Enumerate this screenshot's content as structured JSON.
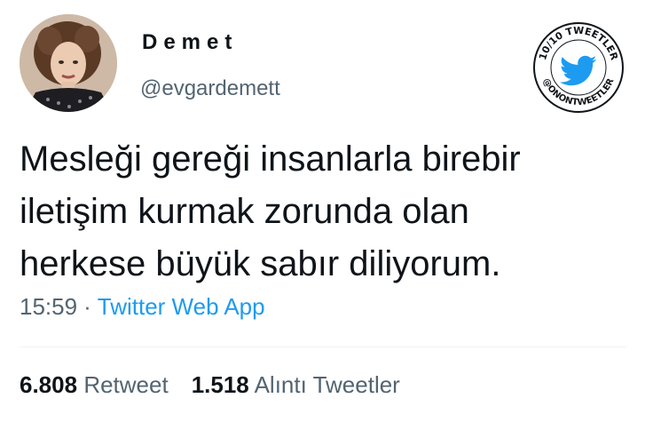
{
  "tweet": {
    "author": {
      "display_name": "Demet",
      "handle": "@evgardemett",
      "avatar_icon": "profile-photo"
    },
    "text_lines": [
      "Mesleği gereği insanlarla birebir",
      "iletişim kurmak zorunda olan",
      "herkese büyük sabır diliyorum."
    ],
    "time": "15:59",
    "separator": "·",
    "source": "Twitter Web App",
    "stats": {
      "retweets_count": "6.808",
      "retweets_label": "Retweet",
      "quotes_count": "1.518",
      "quotes_label": "Alıntı Tweetler"
    }
  },
  "badge": {
    "top_text": "10/10 TWEETLER",
    "bottom_text": "@ONONTWEETLER",
    "icon": "twitter-bird-icon",
    "accent_color": "#1d9bf0"
  }
}
